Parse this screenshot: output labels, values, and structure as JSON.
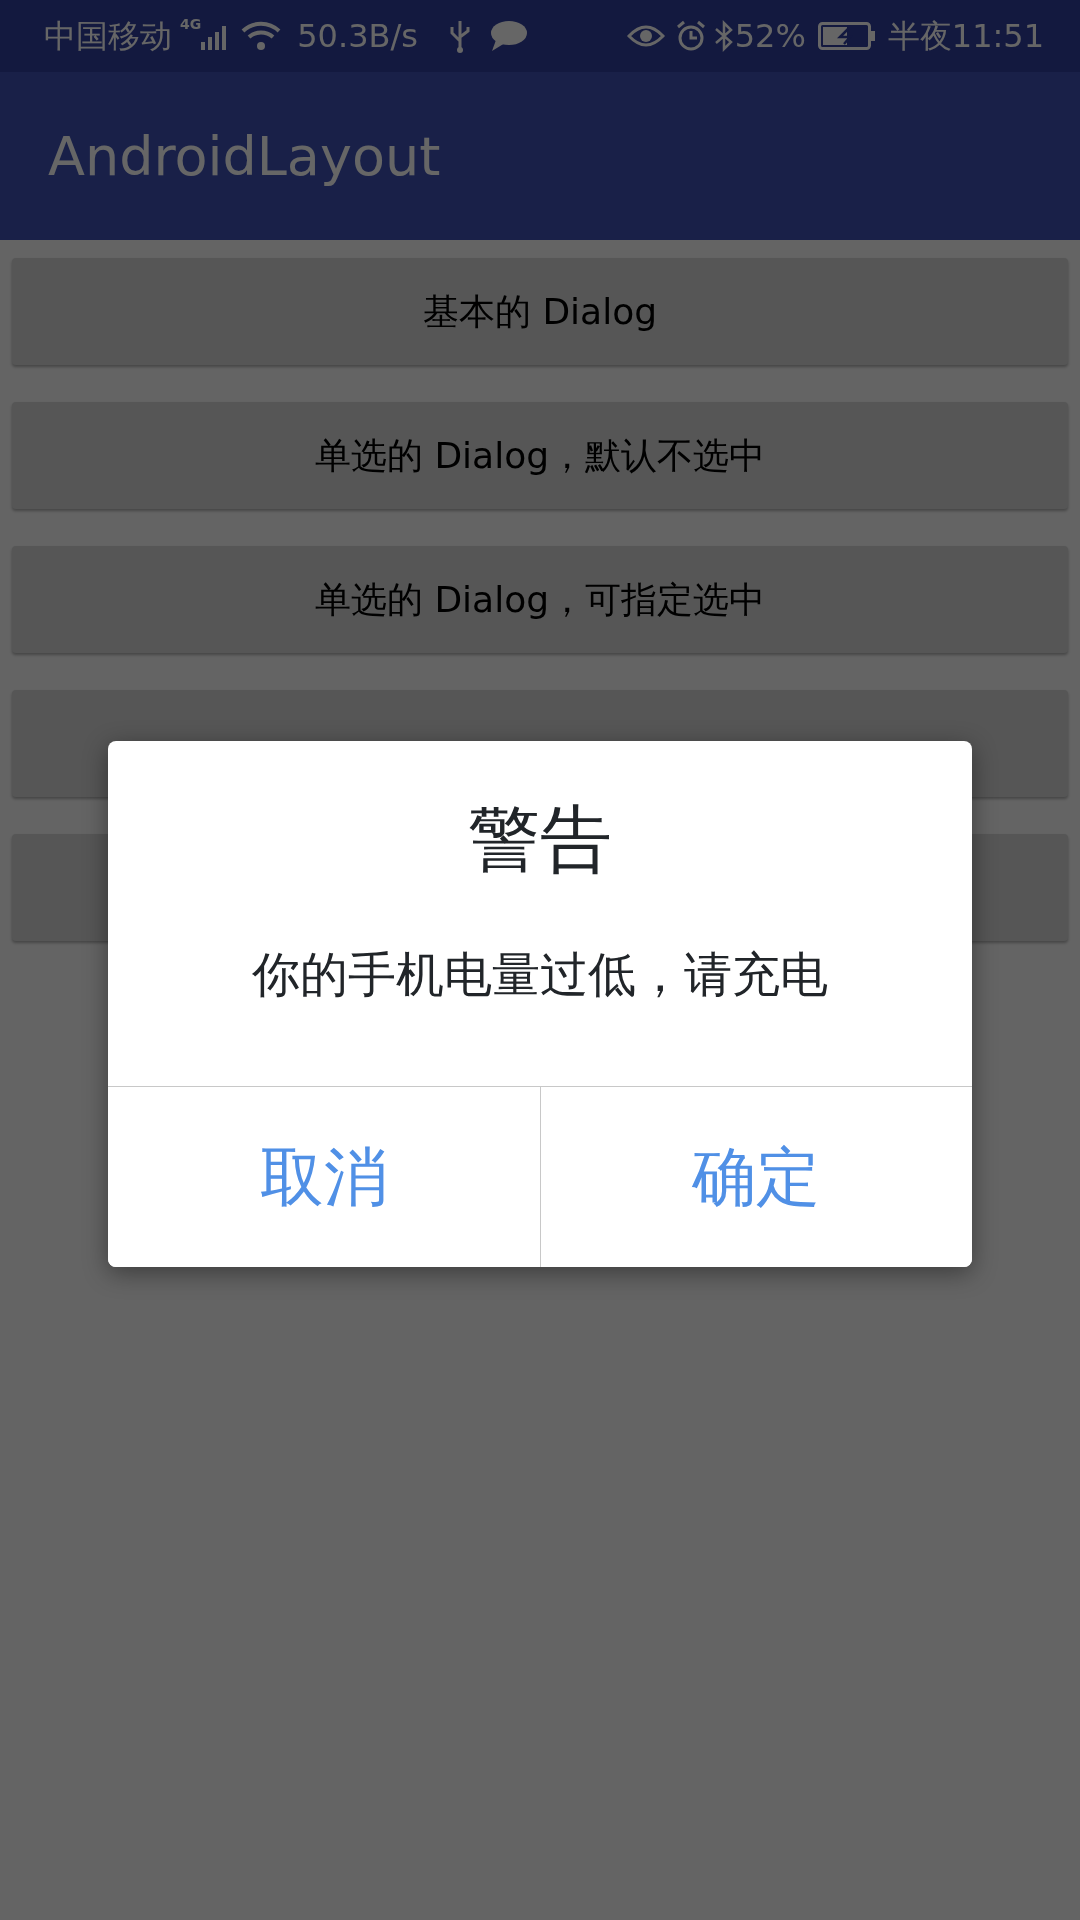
{
  "status_bar": {
    "carrier": "中国移动",
    "network": "4G",
    "speed": "50.3B/s",
    "battery": "52%",
    "time": "半夜11:51"
  },
  "app_bar": {
    "title": "AndroidLayout"
  },
  "buttons": [
    {
      "label": "基本的 Dialog"
    },
    {
      "label": "单选的 Dialog，默认不选中"
    },
    {
      "label": "单选的 Dialog，可指定选中"
    }
  ],
  "dialog": {
    "title": "警告",
    "message": "你的手机电量过低，请充电",
    "actions": [
      {
        "label": "取消"
      },
      {
        "label": "确定"
      }
    ]
  }
}
